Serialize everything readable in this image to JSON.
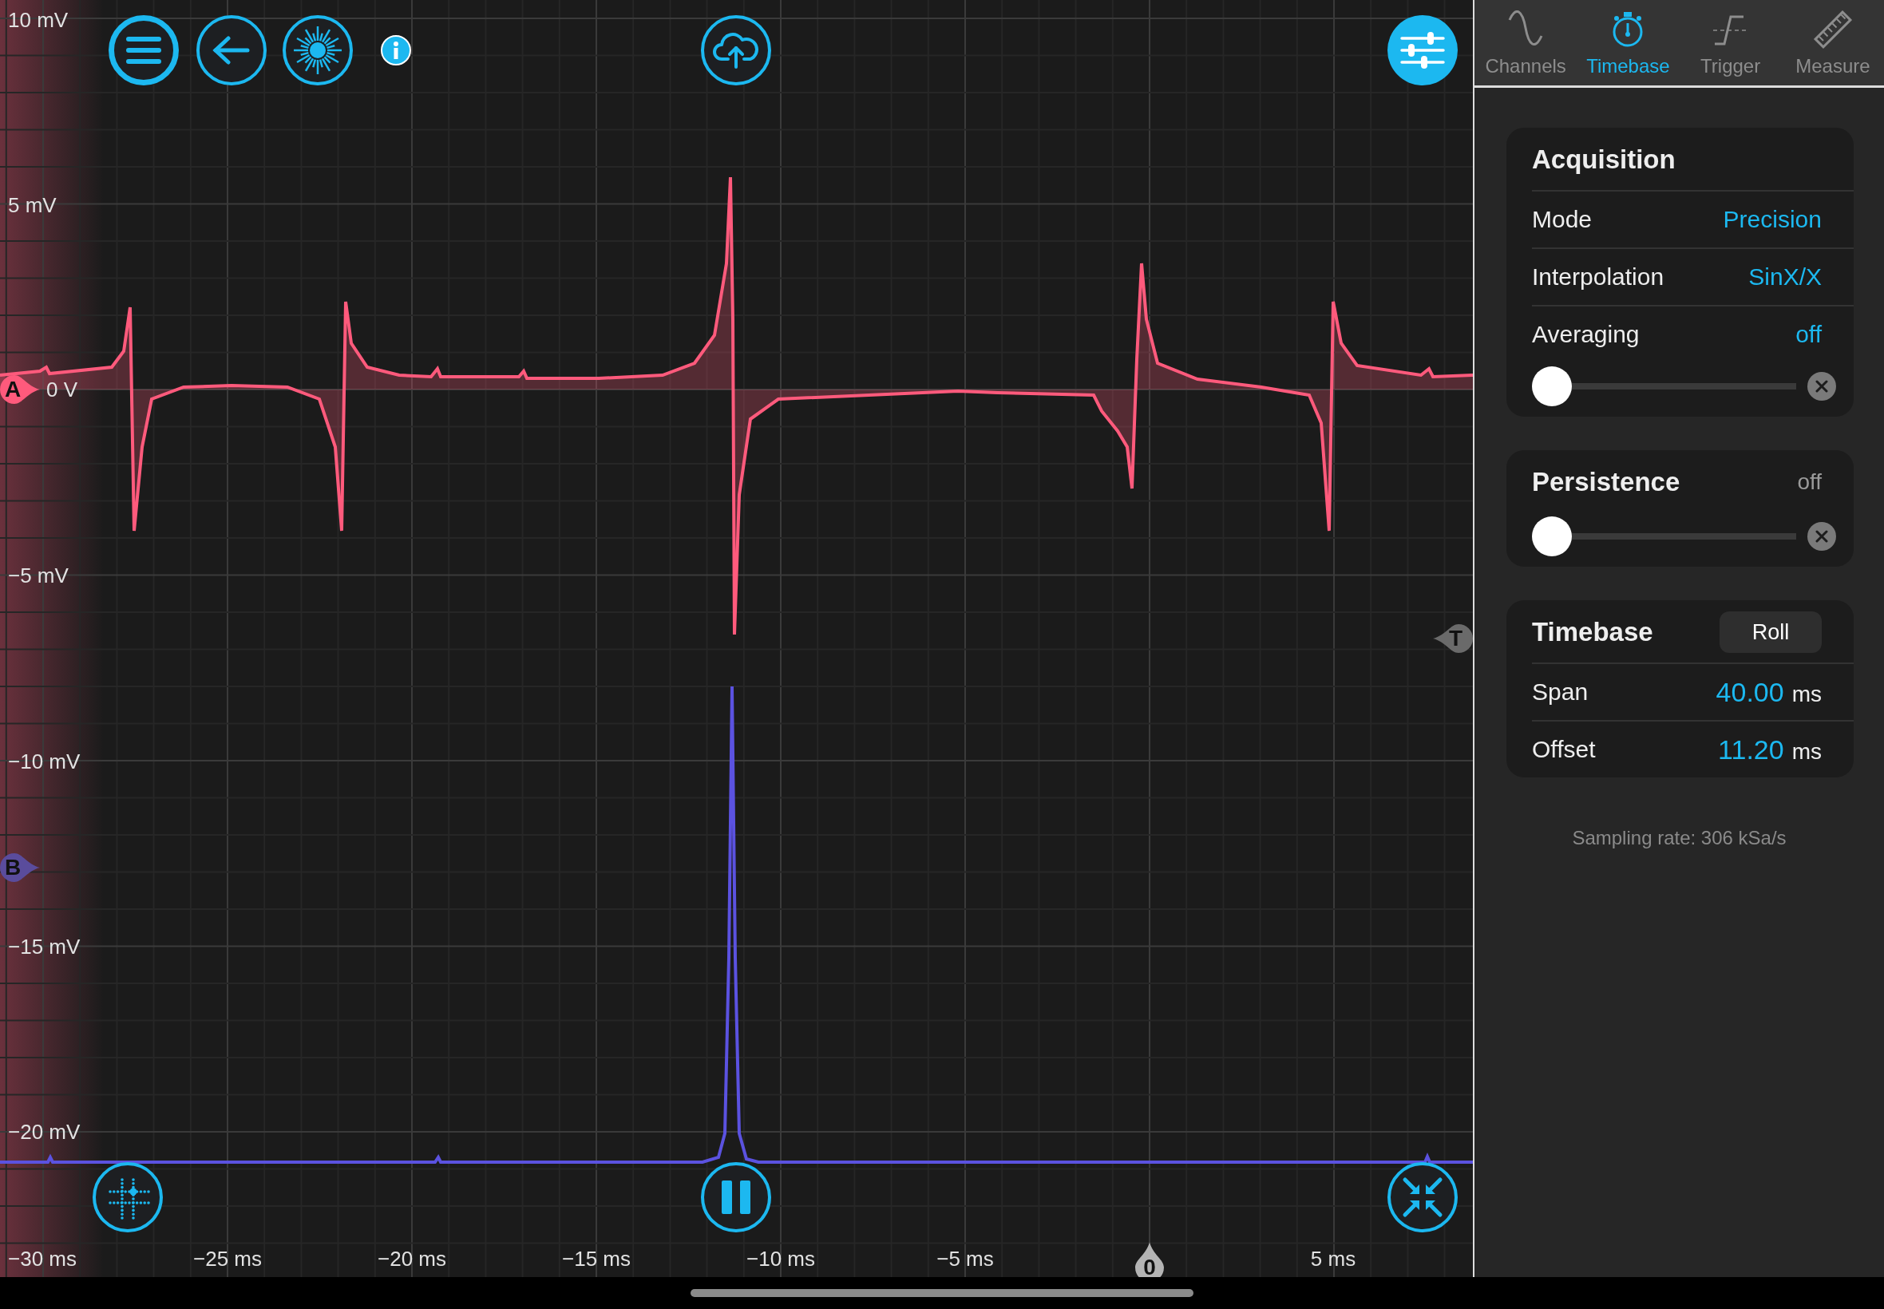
{
  "plot": {
    "y_labels": [
      "10 mV",
      "5 mV",
      "−5 mV",
      "−10 mV",
      "−15 mV",
      "−20 mV"
    ],
    "zero_label": "0 V",
    "x_labels": [
      "−30 ms",
      "−25 ms",
      "−20 ms",
      "−15 ms",
      "−10 ms",
      "−5 ms",
      "5 ms"
    ],
    "markers": [
      {
        "label": "A",
        "kind": "right",
        "color": "#ff5a7c"
      },
      {
        "label": "B",
        "kind": "right",
        "color": "#5a4c9c"
      },
      {
        "label": "T",
        "kind": "left",
        "color": "#6a6a6a"
      },
      {
        "label": "0",
        "kind": "up",
        "color": "#b4b4b4"
      }
    ]
  },
  "tabs": [
    {
      "label": "Channels",
      "kind": "sine",
      "selected": false
    },
    {
      "label": "Timebase",
      "kind": "stopwatch",
      "selected": true
    },
    {
      "label": "Trigger",
      "kind": "trigger",
      "selected": false
    },
    {
      "label": "Measure",
      "kind": "ruler",
      "selected": false
    }
  ],
  "acquisition": {
    "title": "Acquisition",
    "rows": [
      {
        "label": "Mode",
        "value": "Precision"
      },
      {
        "label": "Interpolation",
        "value": "SinX/X"
      },
      {
        "label": "Averaging",
        "value": "off"
      }
    ],
    "slider": {
      "level": 0
    }
  },
  "persistence": {
    "title": "Persistence",
    "value": "off",
    "slider": {
      "level": 0
    }
  },
  "timebase": {
    "title": "Timebase",
    "button": "Roll",
    "rows": [
      {
        "label": "Span",
        "value": "40.00",
        "unit": "ms"
      },
      {
        "label": "Offset",
        "value": "11.20",
        "unit": "ms"
      }
    ]
  },
  "sampling_rate": "Sampling rate: 306 kSa/s"
}
